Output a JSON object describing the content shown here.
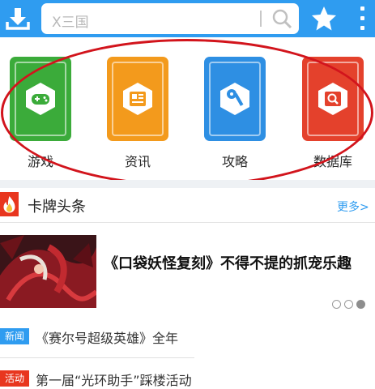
{
  "colors": {
    "accent": "#2f9cf0",
    "highlight_ellipse": "#d2141c",
    "news_tag": "#2f9cf0",
    "event_tag": "#e8361e"
  },
  "topbar": {
    "download_icon": "download-icon",
    "search": {
      "value": "X三国",
      "icon": "search-icon"
    },
    "favorite_icon": "star-icon",
    "menu_icon": "more-vertical-icon"
  },
  "categories": [
    {
      "label": "游戏",
      "icon": "gamepad-icon",
      "color": "#3bab3a"
    },
    {
      "label": "资讯",
      "icon": "newspaper-icon",
      "color": "#f39a1c"
    },
    {
      "label": "攻略",
      "icon": "key-icon",
      "color": "#2e8fe3"
    },
    {
      "label": "数据库",
      "icon": "database-search-icon",
      "color": "#e4412c"
    }
  ],
  "section": {
    "title": "卡牌头条",
    "icon": "fire-icon",
    "more_label": "更多>"
  },
  "feature": {
    "title": "《口袋妖怪复刻》不得不提的抓宠乐趣",
    "image": "dragon-artwork",
    "carousel": {
      "count": 3,
      "active_index": 2
    }
  },
  "news": [
    {
      "tag": "新闻",
      "title": "《赛尔号超级英雄》全年"
    },
    {
      "tag": "活动",
      "title": "第一届“光环助手”踩楼活动"
    }
  ]
}
